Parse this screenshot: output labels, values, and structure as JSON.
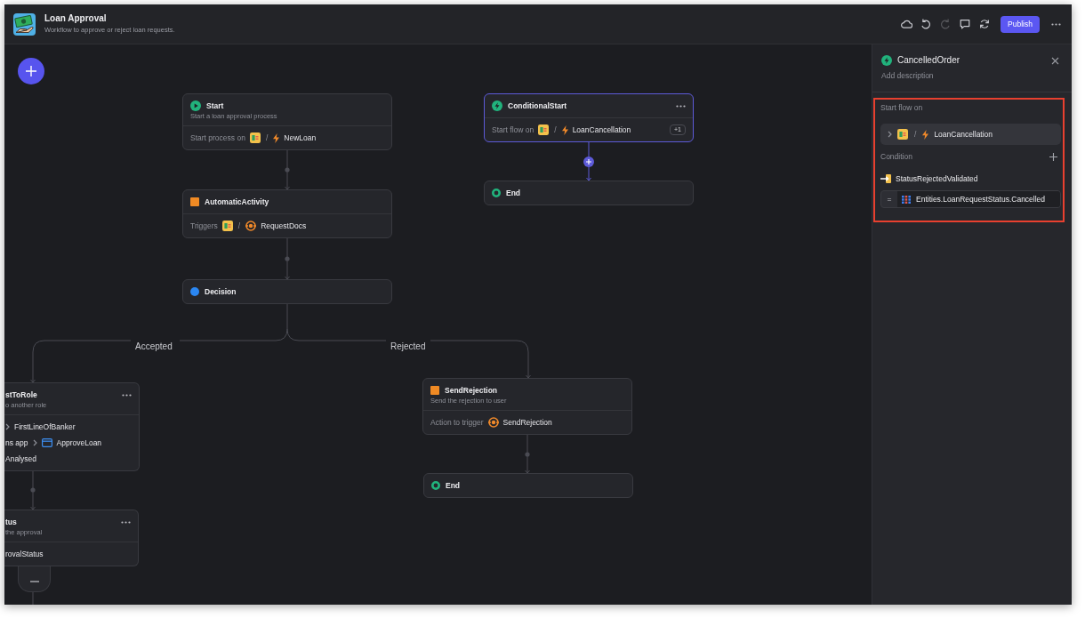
{
  "topbar": {
    "title": "Loan Approval",
    "subtitle": "Workflow to approve or reject loan requests.",
    "actions": [
      {
        "kind": "cloud",
        "disabled": false
      },
      {
        "kind": "undo",
        "disabled": false
      },
      {
        "kind": "redo",
        "disabled": true
      },
      {
        "kind": "comment",
        "disabled": false
      },
      {
        "kind": "sync",
        "disabled": false
      }
    ],
    "publish_label": "Publish"
  },
  "canvas": {
    "nodes": [
      {
        "kind": "start",
        "title": "Start",
        "subtitle": "Start a loan approval process",
        "menu": false,
        "selected": false,
        "rows": [
          [
            {
              "kind": "label",
              "text": "Start process on"
            },
            {
              "kind": "app"
            },
            {
              "kind": "sep",
              "text": "/"
            },
            {
              "kind": "event"
            },
            {
              "kind": "value",
              "text": "NewLoan"
            }
          ]
        ]
      },
      {
        "kind": "conditional_start",
        "title": "ConditionalStart",
        "menu": true,
        "selected": true,
        "rows": [
          [
            {
              "kind": "label",
              "text": "Start flow on"
            },
            {
              "kind": "app"
            },
            {
              "kind": "sep",
              "text": "/"
            },
            {
              "kind": "event"
            },
            {
              "kind": "value",
              "text": "LoanCancellation"
            },
            {
              "kind": "badge",
              "text": "+1"
            }
          ]
        ]
      },
      {
        "kind": "end",
        "title": "End",
        "menu": false,
        "selected": false
      },
      {
        "kind": "activity",
        "title": "AutomaticActivity",
        "menu": false,
        "selected": false,
        "rows": [
          [
            {
              "kind": "label",
              "text": "Triggers"
            },
            {
              "kind": "app"
            },
            {
              "kind": "sep",
              "text": "/"
            },
            {
              "kind": "action"
            },
            {
              "kind": "value",
              "text": "RequestDocs"
            }
          ]
        ]
      },
      {
        "kind": "decision",
        "title": "Decision",
        "menu": false,
        "selected": false
      },
      {
        "kind": "assign",
        "title": "stToRole",
        "subtitle": "o another role",
        "menu": true,
        "selected": false,
        "rows": [
          [
            {
              "kind": "chevron"
            },
            {
              "kind": "value",
              "text": "FirstLineOfBanker"
            }
          ],
          [
            {
              "kind": "value",
              "text": "ns app"
            },
            {
              "kind": "chevron"
            },
            {
              "kind": "window"
            },
            {
              "kind": "value",
              "text": "ApproveLoan"
            }
          ],
          [
            {
              "kind": "value",
              "text": "Analysed"
            }
          ]
        ]
      },
      {
        "kind": "activity",
        "title": "SendRejection",
        "subtitle": "Send the rejection to user",
        "menu": false,
        "selected": false,
        "rows": [
          [
            {
              "kind": "label",
              "text": "Action to trigger"
            },
            {
              "kind": "action"
            },
            {
              "kind": "value",
              "text": "SendRejection"
            }
          ]
        ]
      },
      {
        "kind": "status",
        "title": "tus",
        "subtitle": "the approval",
        "menu": true,
        "selected": false,
        "rows": [
          [
            {
              "kind": "value",
              "text": "rovalStatus"
            }
          ]
        ]
      },
      {
        "kind": "end",
        "title": "End",
        "menu": false,
        "selected": false
      }
    ],
    "branches": [
      {
        "label": "Accepted"
      },
      {
        "label": "Rejected"
      }
    ]
  },
  "panel": {
    "title": "CancelledOrder",
    "description_placeholder": "Add description",
    "highlighted": true,
    "trigger_label": "Start flow on",
    "trigger": {
      "expanded": false,
      "parts": [
        {
          "kind": "app"
        },
        {
          "kind": "sep",
          "text": "/"
        },
        {
          "kind": "event"
        },
        {
          "kind": "value",
          "text": "LoanCancellation"
        }
      ]
    },
    "condition_label": "Condition",
    "condition": {
      "variable": "StatusRejectedValidated",
      "operator": "=",
      "value": "Entities.LoanRequestStatus.Cancelled"
    }
  }
}
